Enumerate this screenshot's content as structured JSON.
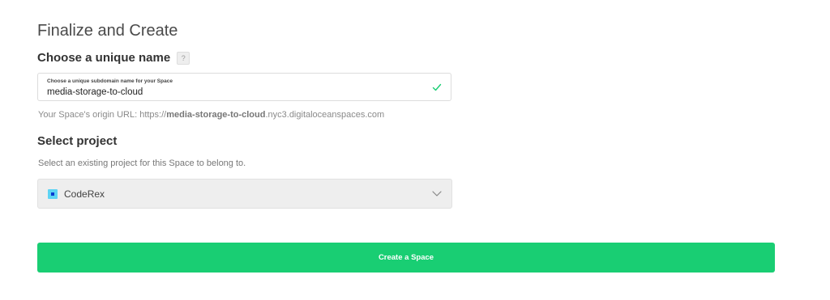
{
  "page": {
    "title": "Finalize and Create"
  },
  "name_section": {
    "heading": "Choose a unique name",
    "help_label": "?",
    "field_label": "Choose a unique subdomain name for your Space",
    "field_value": "media-storage-to-cloud",
    "valid_icon": "check-icon",
    "origin_prefix": "Your Space's origin URL: https://",
    "origin_name": "media-storage-to-cloud",
    "origin_suffix": ".nyc3.digitaloceanspaces.com"
  },
  "project_section": {
    "heading": "Select project",
    "description": "Select an existing project for this Space to belong to.",
    "selected_project": "CodeRex",
    "project_icon": "project-square-icon",
    "dropdown_icon": "chevron-down-icon"
  },
  "actions": {
    "create_label": "Create a Space"
  },
  "colors": {
    "accent_green": "#19ce73",
    "valid_check": "#19ce73",
    "project_icon_bg": "#5ed4f4",
    "project_icon_fg": "#0a3bd1",
    "select_bg": "#eeeeee"
  }
}
